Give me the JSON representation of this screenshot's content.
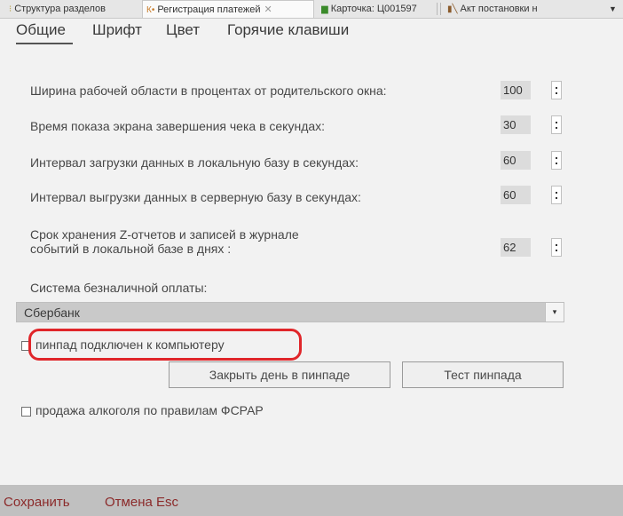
{
  "doc_tabs": [
    {
      "label": "Структура разделов",
      "icon": "structure-icon"
    },
    {
      "label": "Регистрация платежей",
      "icon": "document-icon",
      "close": "✕"
    },
    {
      "label": "Карточка: Ц001597",
      "icon": "card-icon"
    },
    {
      "label": "Акт постановки н",
      "icon": "act-icon"
    }
  ],
  "overflow_glyph": "▼",
  "settings_tabs": [
    "Общие",
    "Шрифт",
    "Цвет",
    "Горячие клавиши"
  ],
  "rows": [
    {
      "label": "Ширина рабочей области в процентах от родительского окна:",
      "value": "100"
    },
    {
      "label": "Время показа экрана завершения чека в секундах:",
      "value": "30"
    },
    {
      "label": "Интервал загрузки данных в локальную базу в секундах:",
      "value": "60"
    },
    {
      "label": "Интервал выгрузки данных в серверную базу в секундах:",
      "value": "60"
    },
    {
      "label_line1": "Срок хранения Z-отчетов и записей в журнале",
      "label_line2": "событий в локальной базе в днях :",
      "value": "62"
    }
  ],
  "payment_system": {
    "label": "Система безналичной оплаты:",
    "selected": "Сбербанк"
  },
  "pinpad_checkbox": {
    "label": "пинпад подключен к компьютеру",
    "checked": false
  },
  "buttons": {
    "close_day": "Закрыть день в пинпаде",
    "test_pinpad": "Тест пинпада"
  },
  "alcohol_checkbox": {
    "label": "продажа алкоголя по правилам ФСРАР",
    "checked": false
  },
  "footer": {
    "save": "Сохранить",
    "cancel": "Отмена Esc"
  },
  "colors": {
    "highlight": "#e0262a",
    "footer_text": "#8b2a2a"
  }
}
